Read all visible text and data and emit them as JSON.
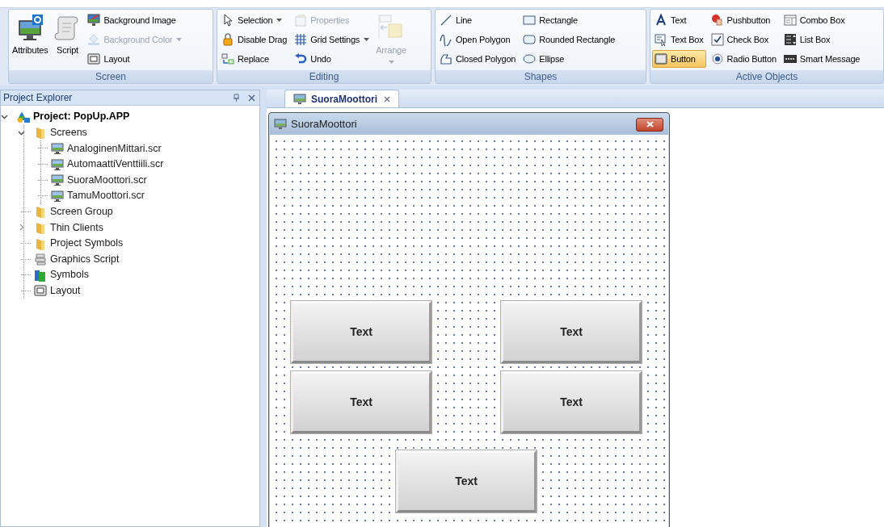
{
  "ribbon": {
    "groups": [
      {
        "label": "Screen",
        "items": [
          {
            "label": "Attributes",
            "kind": "large",
            "disabled": false,
            "dropdown": false,
            "selected": false
          },
          {
            "label": "Script",
            "kind": "large",
            "disabled": false,
            "dropdown": false,
            "selected": false
          },
          {
            "label": "Background Image",
            "kind": "small",
            "disabled": false,
            "dropdown": false,
            "selected": false
          },
          {
            "label": "Background Color",
            "kind": "small",
            "disabled": true,
            "dropdown": true,
            "selected": false
          },
          {
            "label": "Layout",
            "kind": "small",
            "disabled": false,
            "dropdown": false,
            "selected": false
          }
        ]
      },
      {
        "label": "Editing",
        "items": [
          {
            "label": "Selection",
            "kind": "small",
            "disabled": false,
            "dropdown": true,
            "selected": false
          },
          {
            "label": "Disable Drag",
            "kind": "small",
            "disabled": false,
            "dropdown": false,
            "selected": false
          },
          {
            "label": "Replace",
            "kind": "small",
            "disabled": false,
            "dropdown": false,
            "selected": false
          },
          {
            "label": "Properties",
            "kind": "small",
            "disabled": true,
            "dropdown": false,
            "selected": false
          },
          {
            "label": "Grid Settings",
            "kind": "small",
            "disabled": false,
            "dropdown": true,
            "selected": false
          },
          {
            "label": "Undo",
            "kind": "small",
            "disabled": false,
            "dropdown": false,
            "selected": false
          },
          {
            "label": "Arrange",
            "kind": "large",
            "disabled": true,
            "dropdown": true,
            "selected": false
          }
        ]
      },
      {
        "label": "Shapes",
        "items": [
          {
            "label": "Line",
            "kind": "small",
            "disabled": false,
            "dropdown": false,
            "selected": false
          },
          {
            "label": "Open Polygon",
            "kind": "small",
            "disabled": false,
            "dropdown": false,
            "selected": false
          },
          {
            "label": "Closed Polygon",
            "kind": "small",
            "disabled": false,
            "dropdown": false,
            "selected": false
          },
          {
            "label": "Rectangle",
            "kind": "small",
            "disabled": false,
            "dropdown": false,
            "selected": false
          },
          {
            "label": "Rounded Rectangle",
            "kind": "small",
            "disabled": false,
            "dropdown": false,
            "selected": false
          },
          {
            "label": "Ellipse",
            "kind": "small",
            "disabled": false,
            "dropdown": false,
            "selected": false
          }
        ]
      },
      {
        "label": "Active Objects",
        "items": [
          {
            "label": "Text",
            "kind": "small",
            "disabled": false,
            "dropdown": false,
            "selected": false
          },
          {
            "label": "Text Box",
            "kind": "small",
            "disabled": false,
            "dropdown": false,
            "selected": false
          },
          {
            "label": "Button",
            "kind": "small",
            "disabled": false,
            "dropdown": false,
            "selected": true
          },
          {
            "label": "Pushbutton",
            "kind": "small",
            "disabled": false,
            "dropdown": false,
            "selected": false
          },
          {
            "label": "Check Box",
            "kind": "small",
            "disabled": false,
            "dropdown": false,
            "selected": false
          },
          {
            "label": "Radio Button",
            "kind": "small",
            "disabled": false,
            "dropdown": false,
            "selected": false
          },
          {
            "label": "Combo Box",
            "kind": "small",
            "disabled": false,
            "dropdown": false,
            "selected": false
          },
          {
            "label": "List Box",
            "kind": "small",
            "disabled": false,
            "dropdown": false,
            "selected": false
          },
          {
            "label": "Smart Message",
            "kind": "small",
            "disabled": false,
            "dropdown": false,
            "selected": false
          }
        ]
      }
    ]
  },
  "project_explorer": {
    "title": "Project Explorer",
    "tree": [
      {
        "label": "Project: PopUp.APP",
        "kind": "project",
        "expanded": true,
        "children": [
          {
            "label": "Screens",
            "kind": "folder",
            "expanded": true,
            "children": [
              {
                "label": "AnaloginenMittari.scr",
                "kind": "screen"
              },
              {
                "label": "AutomaattiVenttiili.scr",
                "kind": "screen"
              },
              {
                "label": "SuoraMoottori.scr",
                "kind": "screen"
              },
              {
                "label": "TamuMoottori.scr",
                "kind": "screen"
              }
            ]
          },
          {
            "label": "Screen Group",
            "kind": "folder"
          },
          {
            "label": "Thin Clients",
            "kind": "folder",
            "expanded": false
          },
          {
            "label": "Project Symbols",
            "kind": "folder"
          },
          {
            "label": "Graphics Script",
            "kind": "script"
          },
          {
            "label": "Symbols",
            "kind": "symbols"
          },
          {
            "label": "Layout",
            "kind": "layout"
          }
        ]
      }
    ]
  },
  "document_tabs": [
    {
      "label": "SuoraMoottori",
      "selected": true
    }
  ],
  "screen_window": {
    "title": "SuoraMoottori",
    "buttons": [
      {
        "label": "Text"
      },
      {
        "label": "Text"
      },
      {
        "label": "Text"
      },
      {
        "label": "Text"
      },
      {
        "label": "Text"
      }
    ]
  }
}
